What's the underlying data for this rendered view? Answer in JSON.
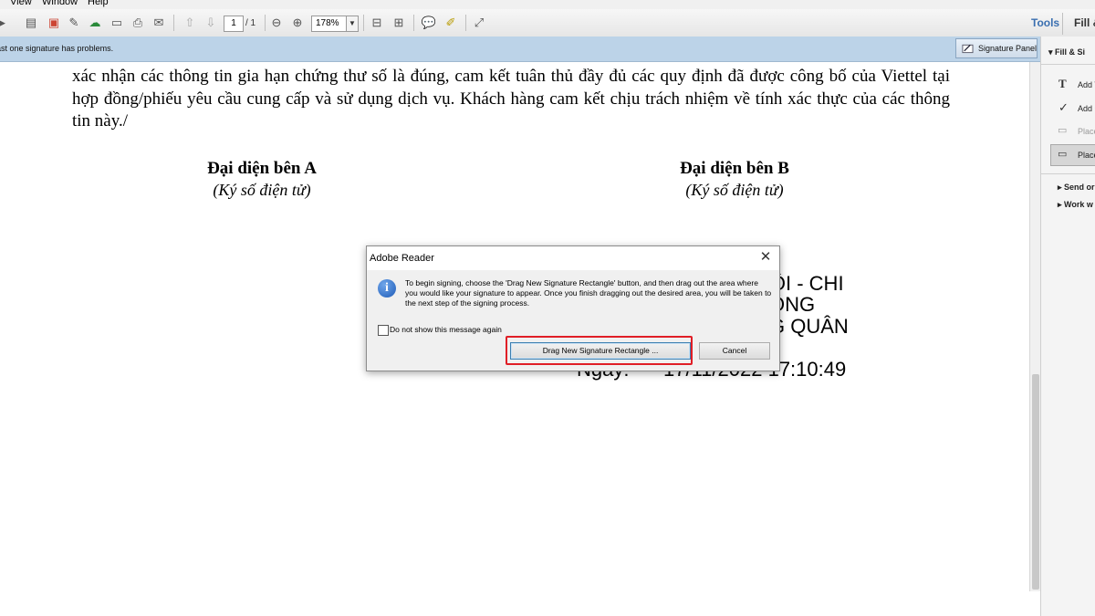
{
  "menu": {
    "items": [
      "View",
      "Window",
      "Help"
    ]
  },
  "toolbar": {
    "page_current": "1",
    "page_total": "/ 1",
    "zoom": "178%",
    "tools_label": "Tools",
    "fill_sign_label": "Fill & Si"
  },
  "notification": {
    "message": "ast one signature has problems.",
    "signature_panel_label": "Signature Panel"
  },
  "right_pane": {
    "header": "Fill & Si",
    "items": [
      "Add T",
      "Add C",
      "Place",
      "Place"
    ],
    "sections": [
      "Send or",
      "Work w"
    ]
  },
  "document": {
    "paragraph_line1": "xác nhận các thông tin gia hạn chứng thư số là đúng, cam kết tuân thủ đầy đủ các quy định đã được công bố của",
    "paragraph_rest": "Viettel tại hợp đồng/phiếu yêu cầu cung cấp và sử dụng dịch vụ. Khách hàng cam kết chịu trách nhiệm về tính xác thực của các thông tin này./",
    "party_a_title": "Đại diện bên A",
    "party_a_sub": "(Ký số điện tử)",
    "party_b_title": "Đại diện bên B",
    "party_b_sub": "(Ký số điện tử)",
    "sig_line1": "NỘI - CHI",
    "sig_line2": "ÔNG",
    "sig_line3": "G QUÂN",
    "sig_date_label": "Ngày:",
    "sig_date_value": "17/11/2022 17:10:49"
  },
  "dialog": {
    "title": "Adobe Reader",
    "message": "To begin signing, choose the 'Drag New Signature Rectangle' button, and then drag out the area where you would like your signature to appear. Once you finish dragging out the desired area, you will be taken to the next step of the signing process.",
    "checkbox_label": "Do not show this message again",
    "primary_button": "Drag New Signature Rectangle ...",
    "cancel_button": "Cancel"
  },
  "colors": {
    "accent": "#3a6fb0",
    "notification_bg": "#bcd3e8",
    "highlight_outline": "#e01e26"
  }
}
